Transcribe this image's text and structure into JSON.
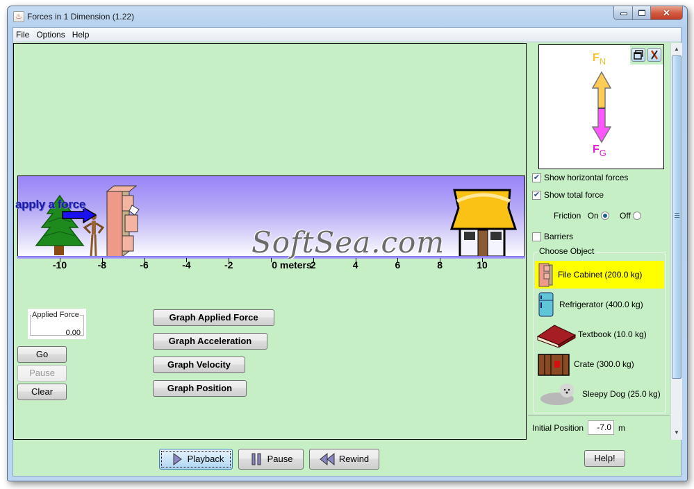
{
  "window": {
    "title": "Forces in 1 Dimension (1.22)",
    "controls": {
      "minimize": "minimize",
      "maximize": "maximize",
      "close": "close"
    }
  },
  "menubar": {
    "items": [
      "File",
      "Options",
      "Help"
    ]
  },
  "stage": {
    "apply_force_label": "apply a force",
    "watermark": "SoftSea.com",
    "axis": {
      "ticks": [
        -10,
        -8,
        -6,
        -4,
        -2,
        0,
        2,
        4,
        6,
        8,
        10
      ],
      "labels": [
        "-10",
        "-8",
        "-6",
        "-4",
        "-2",
        "0 meters",
        "2",
        "4",
        "6",
        "8",
        "10"
      ],
      "unit": "meters"
    },
    "objects": {
      "tree": "tree-icon",
      "pusher": "wooden-figure",
      "cabinet": "file-cabinet",
      "house": "house-icon"
    },
    "object_position_m": -7.0,
    "pusher_position_m": -8.3
  },
  "controls": {
    "applied_force": {
      "label": "Applied Force",
      "value": "0.00"
    },
    "go": "Go",
    "pause": "Pause",
    "clear": "Clear",
    "graphs": [
      "Graph Applied Force",
      "Graph Acceleration",
      "Graph Velocity",
      "Graph Position"
    ]
  },
  "fbd": {
    "normal_label": "F",
    "normal_sub": "N",
    "gravity_label": "F",
    "gravity_sub": "G",
    "colors": {
      "normal": "#ffcc55",
      "gravity": "#ff55ff",
      "normal_text": "#f6c32a",
      "gravity_text": "#e020d0"
    }
  },
  "options": {
    "show_horizontal_forces": {
      "label": "Show horizontal forces",
      "checked": true
    },
    "show_total_force": {
      "label": "Show total force",
      "checked": true
    },
    "friction": {
      "label": "Friction",
      "on": "On",
      "off": "Off",
      "selected": "On"
    },
    "barriers": {
      "label": "Barriers",
      "checked": false
    }
  },
  "choose_object": {
    "legend": "Choose Object",
    "items": [
      {
        "label": "File Cabinet (200.0 kg)",
        "icon": "file-cabinet-icon",
        "selected": true
      },
      {
        "label": "Refrigerator (400.0 kg)",
        "icon": "refrigerator-icon",
        "selected": false
      },
      {
        "label": "Textbook (10.0 kg)",
        "icon": "textbook-icon",
        "selected": false
      },
      {
        "label": "Crate (300.0 kg)",
        "icon": "crate-icon",
        "selected": false
      },
      {
        "label": "Sleepy Dog (25.0 kg)",
        "icon": "dog-icon",
        "selected": false
      }
    ]
  },
  "initial_position": {
    "label": "Initial Position",
    "value": "-7.0",
    "unit": "m"
  },
  "playback": {
    "playback": "Playback",
    "pause": "Pause",
    "rewind": "Rewind"
  },
  "help": "Help!"
}
